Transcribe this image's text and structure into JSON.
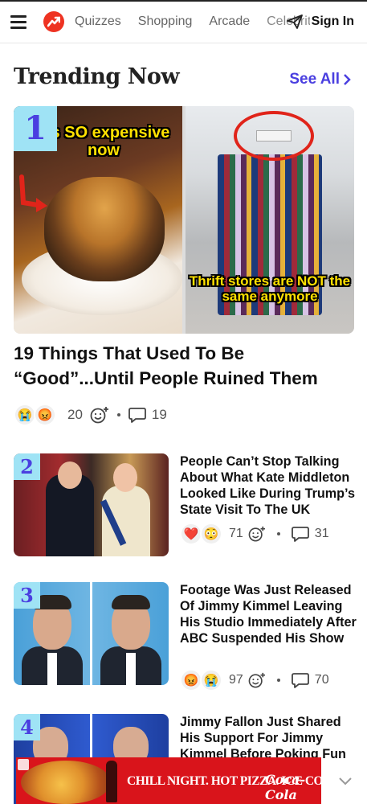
{
  "nav": {
    "items": [
      "Quizzes",
      "Shopping",
      "Arcade",
      "Celebrity"
    ],
    "signin": "Sign In"
  },
  "section": {
    "title": "Trending Now",
    "see_all": "See All"
  },
  "hero": {
    "rank": "1",
    "caption_left": "It's SO expensive now",
    "caption_right": "Thrift stores are NOT the same anymore",
    "title": "19 Things That Used To Be “Good”...Until People Ruined Them",
    "emojis": [
      "😭",
      "😡"
    ],
    "reactions": "20",
    "comments": "19"
  },
  "cards": [
    {
      "rank": "2",
      "title": "People Can’t Stop Talking About What Kate Middleton Looked Like During Trump’s State Visit To The UK",
      "emojis": [
        "❤️",
        "😳"
      ],
      "reactions": "71",
      "comments": "31"
    },
    {
      "rank": "3",
      "title": "Footage Was Just Released Of Jimmy Kimmel Leaving His Studio Immediately After ABC Suspended His Show",
      "emojis": [
        "😡",
        "😭"
      ],
      "reactions": "97",
      "comments": "70"
    },
    {
      "rank": "4",
      "title": "Jimmy Fallon Just Shared His Support For Jimmy Kimmel Before Poking Fun"
    }
  ],
  "ad": {
    "text": "CHILL NIGHT. HOT PIZZA. ICE COLD.",
    "brand": "Coca-Cola"
  },
  "colors": {
    "accent": "#4a3fe0",
    "rank_badge": "#9fe3f5",
    "logo": "#ee3322",
    "ad_red": "#d9141b"
  }
}
